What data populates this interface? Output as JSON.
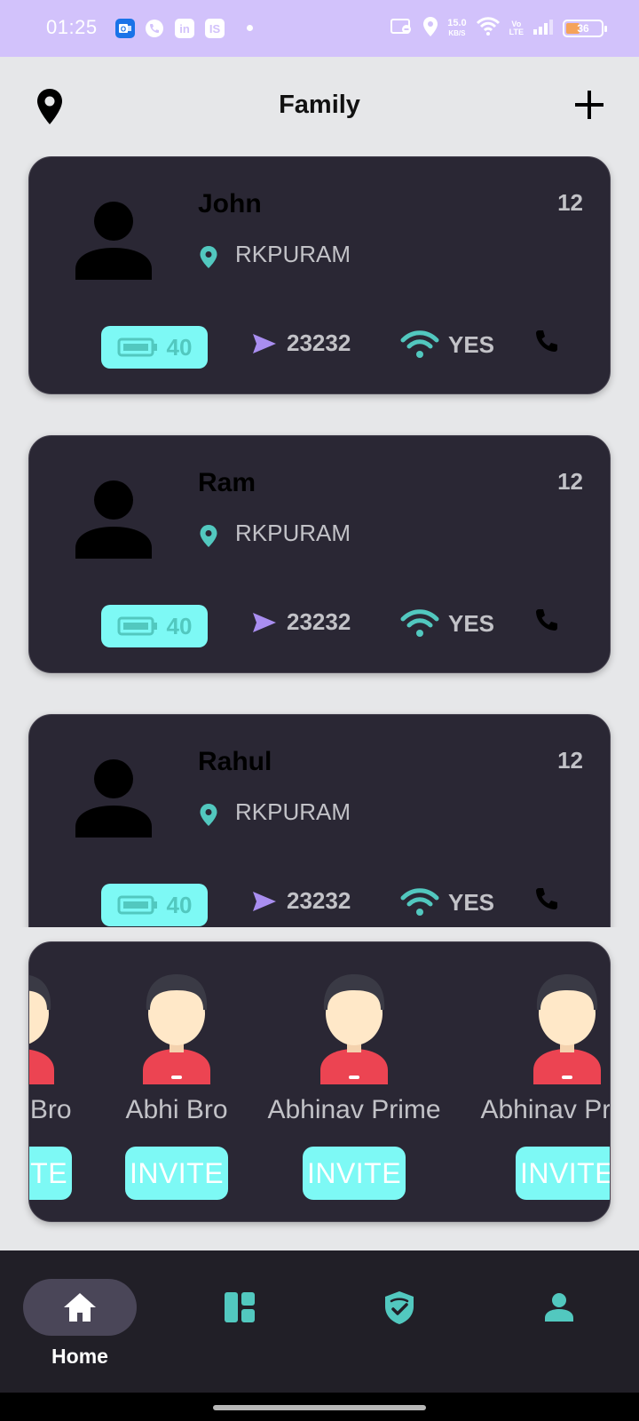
{
  "status_bar": {
    "time": "01:25",
    "icons": [
      "outlook-icon",
      "phone-icon",
      "linkedin-icon",
      "is-icon"
    ],
    "speed_value": "15.0",
    "speed_unit": "KB/S",
    "volte_top": "Vo",
    "volte_bottom": "LTE",
    "battery_level": "36"
  },
  "header": {
    "title": "Family",
    "left_icon": "location-pin-icon",
    "right_icon": "plus-icon"
  },
  "members": [
    {
      "name": "John",
      "location": "RKPURAM",
      "count": "12",
      "battery": "40",
      "speed": "23232",
      "wifi": "YES"
    },
    {
      "name": "Ram",
      "location": "RKPURAM",
      "count": "12",
      "battery": "40",
      "speed": "23232",
      "wifi": "YES"
    },
    {
      "name": "Rahul",
      "location": "RKPURAM",
      "count": "12",
      "battery": "40",
      "speed": "23232",
      "wifi": "YES"
    }
  ],
  "contacts": [
    {
      "name": "Abhi Bro",
      "invite_label": "INVITE"
    },
    {
      "name": "Abhi Bro",
      "invite_label": "INVITE"
    },
    {
      "name": "Abhinav Prime",
      "invite_label": "INVITE"
    },
    {
      "name": "Abhinav Prime",
      "invite_label": "INVITE"
    }
  ],
  "bottom_nav": {
    "items": [
      {
        "label": "Home",
        "icon": "home-icon",
        "active": true
      },
      {
        "label": "",
        "icon": "dashboard-icon",
        "active": false
      },
      {
        "label": "",
        "icon": "shield-check-icon",
        "active": false
      },
      {
        "label": "",
        "icon": "person-icon",
        "active": false
      }
    ]
  },
  "colors": {
    "status_bar": "#d2c2fb",
    "card_bg": "#2a2734",
    "accent_teal": "#52c8bf",
    "pill_cyan": "#7df9f5",
    "send_purple": "#a98ef0",
    "nav_bg": "#211f27"
  }
}
